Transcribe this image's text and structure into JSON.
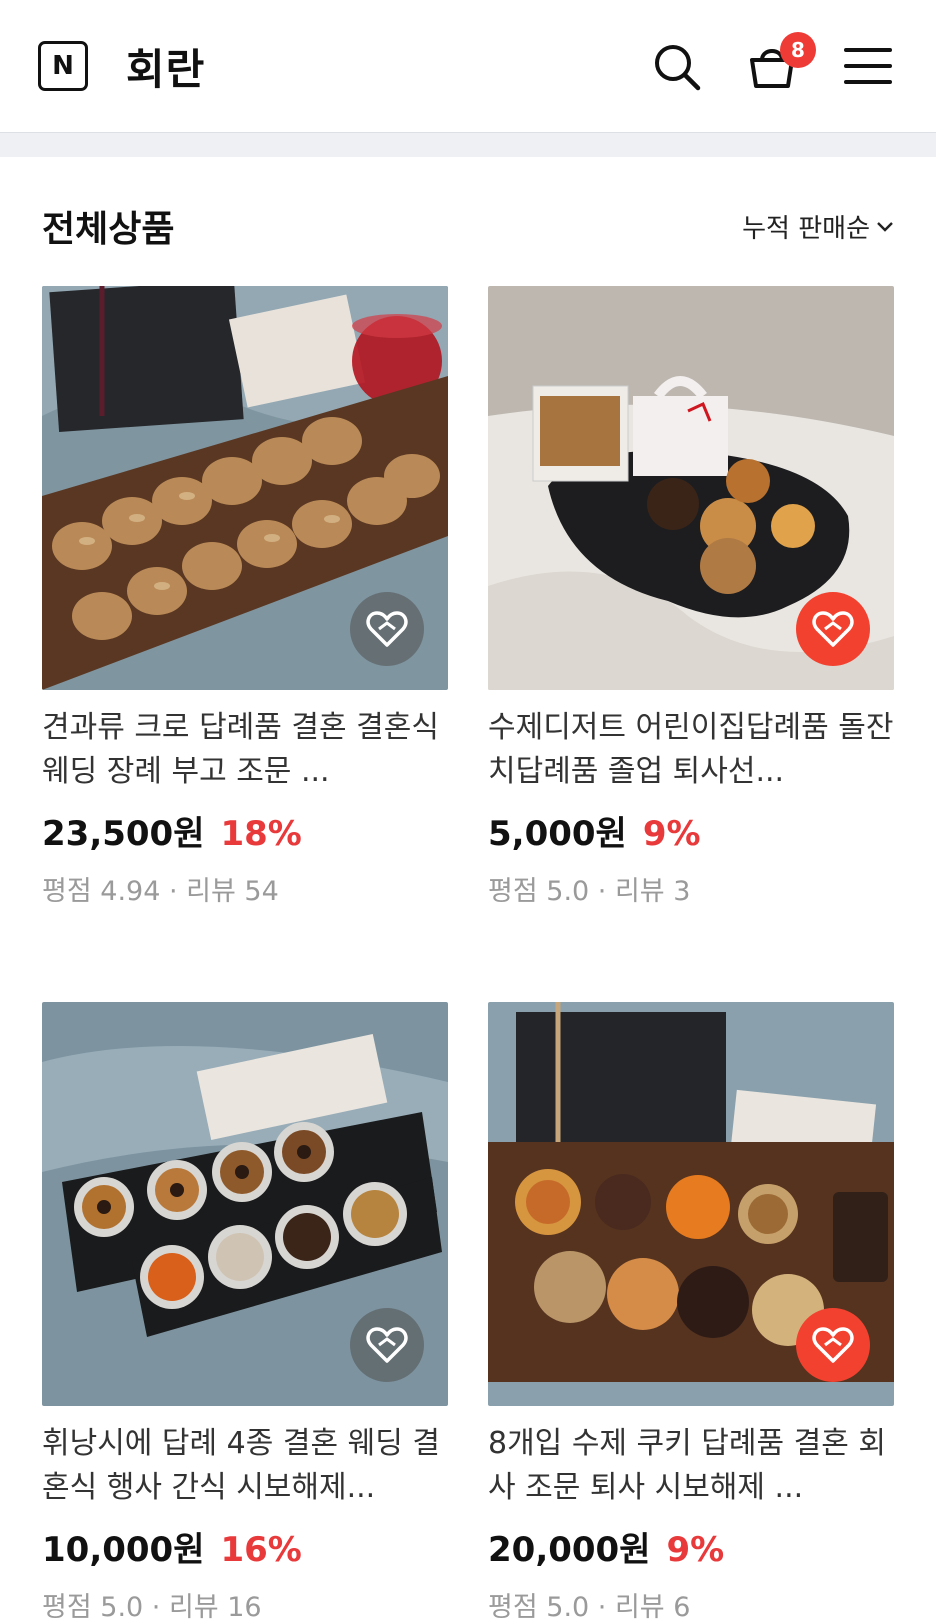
{
  "header": {
    "logo_letter": "N",
    "store_name": "회란",
    "cart_count": "8"
  },
  "section": {
    "title": "전체상품",
    "sort_label": "누적 판매순"
  },
  "products": [
    {
      "title": "견과류 크로 답례품 결혼 결혼식 웨딩 장례 부고 조문 ...",
      "price": "23,500원",
      "discount": "18%",
      "meta": "평점 4.94 · 리뷰 54",
      "liked": false
    },
    {
      "title": "수제디저트 어린이집답례품 돌잔치답례품 졸업 퇴사선...",
      "price": "5,000원",
      "discount": "9%",
      "meta": "평점 5.0 · 리뷰 3",
      "liked": true
    },
    {
      "title": "휘낭시에 답례 4종 결혼 웨딩 결혼식 행사 간식 시보해제...",
      "price": "10,000원",
      "discount": "16%",
      "meta": "평점 5.0 · 리뷰 16",
      "liked": false
    },
    {
      "title": "8개입 수제 쿠키 답례품 결혼 회사 조문 퇴사 시보해제 ...",
      "price": "20,000원",
      "discount": "9%",
      "meta": "평점 5.0 · 리뷰 6",
      "liked": true
    }
  ],
  "colors": {
    "accent_red": "#e8393b",
    "heart_active": "#f2412f"
  },
  "icons": [
    "search-icon",
    "shopping-bag-icon",
    "menu-icon",
    "chevron-down-icon",
    "heart-icon"
  ]
}
